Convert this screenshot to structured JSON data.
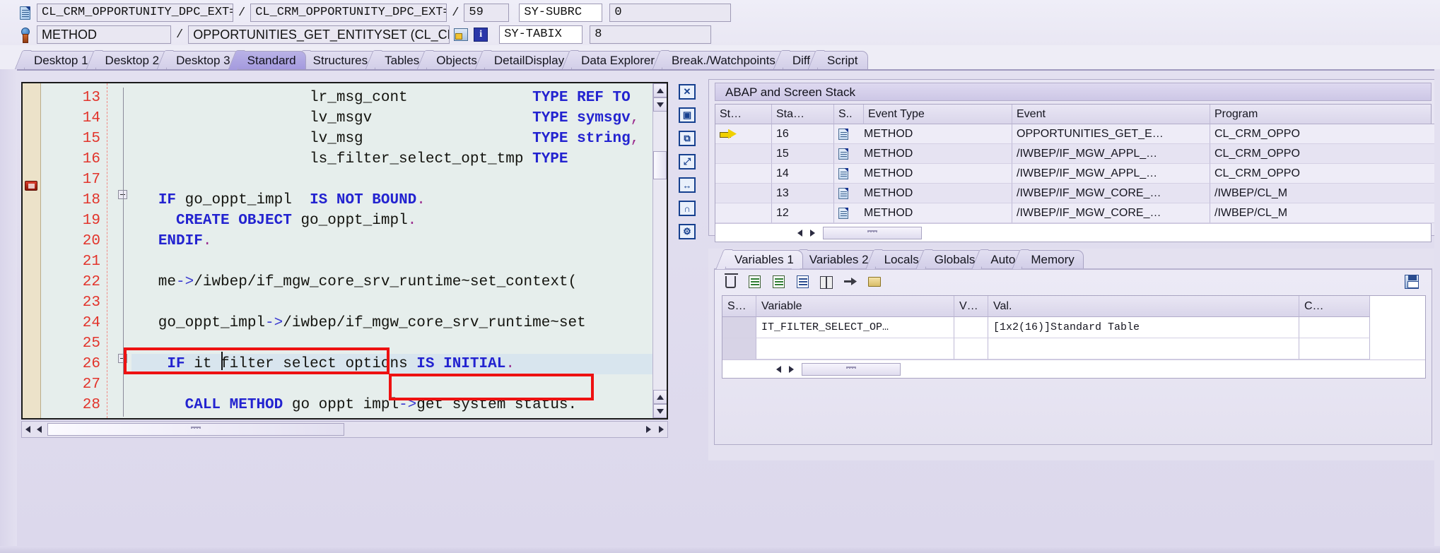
{
  "header": {
    "row1": {
      "program_icon": "abap-program-icon",
      "class_name": "CL_CRM_OPPORTUNITY_DPC_EXT===…",
      "separator": "/",
      "include_name": "CL_CRM_OPPORTUNITY_DPC_EXT===…",
      "separator2": "/",
      "line_number": "59",
      "subrc_label": "SY-SUBRC",
      "subrc_value": "0"
    },
    "row2": {
      "method_icon": "method-icon",
      "event_type": "METHOD",
      "separator": "/",
      "event_name": "OPPORTUNITIES_GET_ENTITYSET (CL_CRM_OPPORTU…",
      "screen_icon": "screen-icon",
      "info_icon": "information-icon",
      "tabix_label": "SY-TABIX",
      "tabix_value": "8"
    }
  },
  "tabs": [
    {
      "label": "Desktop 1",
      "active": false
    },
    {
      "label": "Desktop 2",
      "active": false
    },
    {
      "label": "Desktop 3",
      "active": false
    },
    {
      "label": "Standard",
      "active": true
    },
    {
      "label": "Structures",
      "active": false
    },
    {
      "label": "Tables",
      "active": false
    },
    {
      "label": "Objects",
      "active": false
    },
    {
      "label": "DetailDisplay",
      "active": false
    },
    {
      "label": "Data Explorer",
      "active": false
    },
    {
      "label": "Break./Watchpoints",
      "active": false
    },
    {
      "label": "Diff",
      "active": false
    },
    {
      "label": "Script",
      "active": false
    }
  ],
  "code": {
    "lines": [
      {
        "num": "13",
        "fold": false,
        "highlight": false,
        "breakpoint": false,
        "segments": [
          {
            "t": "                    lr_msg_cont              ",
            "c": "plain"
          },
          {
            "t": "TYPE REF TO",
            "c": "kw"
          }
        ]
      },
      {
        "num": "14",
        "fold": false,
        "highlight": false,
        "breakpoint": false,
        "segments": [
          {
            "t": "                    lv_msgv                  ",
            "c": "plain"
          },
          {
            "t": "TYPE symsgv",
            "c": "kw"
          },
          {
            "t": ",",
            "c": "pn"
          }
        ]
      },
      {
        "num": "15",
        "fold": false,
        "highlight": false,
        "breakpoint": false,
        "segments": [
          {
            "t": "                    lv_msg                   ",
            "c": "plain"
          },
          {
            "t": "TYPE string",
            "c": "kw"
          },
          {
            "t": ",",
            "c": "pn"
          }
        ]
      },
      {
        "num": "16",
        "fold": false,
        "highlight": false,
        "breakpoint": false,
        "segments": [
          {
            "t": "                    ls_filter_select_opt_tmp ",
            "c": "plain"
          },
          {
            "t": "TYPE",
            "c": "kw"
          }
        ]
      },
      {
        "num": "17",
        "fold": false,
        "highlight": false,
        "breakpoint": false,
        "segments": [
          {
            "t": "",
            "c": "plain"
          }
        ]
      },
      {
        "num": "18",
        "fold": true,
        "highlight": false,
        "breakpoint": true,
        "segments": [
          {
            "t": "   ",
            "c": "plain"
          },
          {
            "t": "IF",
            "c": "kw"
          },
          {
            "t": " go_oppt_impl  ",
            "c": "plain"
          },
          {
            "t": "IS NOT BOUND",
            "c": "kw"
          },
          {
            "t": ".",
            "c": "pn"
          }
        ]
      },
      {
        "num": "19",
        "fold": false,
        "highlight": false,
        "breakpoint": false,
        "segments": [
          {
            "t": "     ",
            "c": "plain"
          },
          {
            "t": "CREATE OBJECT",
            "c": "kw"
          },
          {
            "t": " go_oppt_impl",
            "c": "plain"
          },
          {
            "t": ".",
            "c": "pn"
          }
        ]
      },
      {
        "num": "20",
        "fold": false,
        "highlight": false,
        "breakpoint": false,
        "segments": [
          {
            "t": "   ",
            "c": "plain"
          },
          {
            "t": "ENDIF",
            "c": "kw"
          },
          {
            "t": ".",
            "c": "pn"
          }
        ]
      },
      {
        "num": "21",
        "fold": false,
        "highlight": false,
        "breakpoint": false,
        "segments": [
          {
            "t": "",
            "c": "plain"
          }
        ]
      },
      {
        "num": "22",
        "fold": false,
        "highlight": false,
        "breakpoint": false,
        "segments": [
          {
            "t": "   me",
            "c": "plain"
          },
          {
            "t": "->",
            "c": "op"
          },
          {
            "t": "/iwbep/if_mgw_core_srv_runtime~set_context(",
            "c": "plain"
          }
        ]
      },
      {
        "num": "23",
        "fold": false,
        "highlight": false,
        "breakpoint": false,
        "segments": [
          {
            "t": "",
            "c": "plain"
          }
        ]
      },
      {
        "num": "24",
        "fold": false,
        "highlight": false,
        "breakpoint": false,
        "segments": [
          {
            "t": "   go_oppt_impl",
            "c": "plain"
          },
          {
            "t": "->",
            "c": "op"
          },
          {
            "t": "/iwbep/if_mgw_core_srv_runtime~set",
            "c": "plain"
          }
        ]
      },
      {
        "num": "25",
        "fold": false,
        "highlight": false,
        "breakpoint": false,
        "segments": [
          {
            "t": "",
            "c": "plain"
          }
        ]
      },
      {
        "num": "26",
        "fold": true,
        "highlight": true,
        "breakpoint": false,
        "segments": [
          {
            "t": "    ",
            "c": "plain"
          },
          {
            "t": "IF",
            "c": "kw"
          },
          {
            "t": " it filter select options ",
            "c": "plain"
          },
          {
            "t": "IS INITIAL",
            "c": "kw"
          },
          {
            "t": ".",
            "c": "pn"
          }
        ]
      },
      {
        "num": "27",
        "fold": false,
        "highlight": false,
        "breakpoint": false,
        "segments": [
          {
            "t": "",
            "c": "plain"
          }
        ]
      },
      {
        "num": "28",
        "fold": false,
        "highlight": false,
        "breakpoint": false,
        "segments": [
          {
            "t": "      ",
            "c": "plain"
          },
          {
            "t": "CALL METHOD",
            "c": "kw"
          },
          {
            "t": " go oppt impl",
            "c": "plain"
          },
          {
            "t": "->",
            "c": "op"
          },
          {
            "t": "get system status.",
            "c": "plain"
          }
        ]
      }
    ],
    "annotations": [
      {
        "name": "highlight-box-filter-select-options",
        "color": "#ee1111"
      },
      {
        "name": "highlight-box-get-system-status",
        "color": "#ee1111"
      }
    ]
  },
  "vertical_toolbar": [
    {
      "name": "close-editor-icon",
      "glyph": "✕"
    },
    {
      "name": "new-window-icon",
      "glyph": "▣"
    },
    {
      "name": "layout-swap-icon",
      "glyph": "⧉"
    },
    {
      "name": "maximize-icon",
      "glyph": "⤢"
    },
    {
      "name": "fit-width-icon",
      "glyph": "↔"
    },
    {
      "name": "headphones-icon",
      "glyph": "∩"
    },
    {
      "name": "settings-tools-icon",
      "glyph": "⚙"
    }
  ],
  "stack_panel": {
    "title": "ABAP and Screen Stack",
    "columns": [
      "St…",
      "Sta…",
      "S..",
      "Event Type",
      "Event",
      "Program"
    ],
    "rows": [
      {
        "current": true,
        "stack": "16",
        "icon": "method-doc-icon",
        "event_type": "METHOD",
        "event": "OPPORTUNITIES_GET_E…",
        "program": "CL_CRM_OPPO"
      },
      {
        "current": false,
        "stack": "15",
        "icon": "method-doc-icon",
        "event_type": "METHOD",
        "event": "/IWBEP/IF_MGW_APPL_…",
        "program": "CL_CRM_OPPO"
      },
      {
        "current": false,
        "stack": "14",
        "icon": "method-doc-icon",
        "event_type": "METHOD",
        "event": "/IWBEP/IF_MGW_APPL_…",
        "program": "CL_CRM_OPPO"
      },
      {
        "current": false,
        "stack": "13",
        "icon": "method-doc-icon",
        "event_type": "METHOD",
        "event": "/IWBEP/IF_MGW_CORE_…",
        "program": "/IWBEP/CL_M"
      },
      {
        "current": false,
        "stack": "12",
        "icon": "method-doc-icon",
        "event_type": "METHOD",
        "event": "/IWBEP/IF_MGW_CORE_…",
        "program": "/IWBEP/CL_M"
      }
    ]
  },
  "variables_panel": {
    "tabs": [
      {
        "label": "Variables 1",
        "active": true
      },
      {
        "label": "Variables 2",
        "active": false
      },
      {
        "label": "Locals",
        "active": false
      },
      {
        "label": "Globals",
        "active": false
      },
      {
        "label": "Auto",
        "active": false
      },
      {
        "label": "Memory",
        "active": false
      }
    ],
    "toolbar": [
      {
        "name": "delete-icon"
      },
      {
        "name": "insert-row-icon"
      },
      {
        "name": "copy-row-icon"
      },
      {
        "name": "paste-row-icon"
      },
      {
        "name": "compare-icon"
      },
      {
        "name": "goto-icon"
      },
      {
        "name": "folder-icon"
      },
      {
        "name": "save-icon"
      }
    ],
    "columns": [
      "S…",
      "Variable",
      "V…",
      "Val.",
      "C…"
    ],
    "rows": [
      {
        "s": "",
        "variable": "IT_FILTER_SELECT_OP…",
        "v": "",
        "value": "[1x2(16)]Standard Table",
        "c": ""
      },
      {
        "s": "",
        "variable": "",
        "v": "",
        "value": "",
        "c": ""
      }
    ]
  },
  "colors": {
    "keyword": "#2323d0",
    "line_number": "#e2342b",
    "annotation": "#ee1111",
    "tab_active": "#a49ade",
    "code_background": "#e6eeec",
    "highlight_row": "#d8e5ee"
  }
}
